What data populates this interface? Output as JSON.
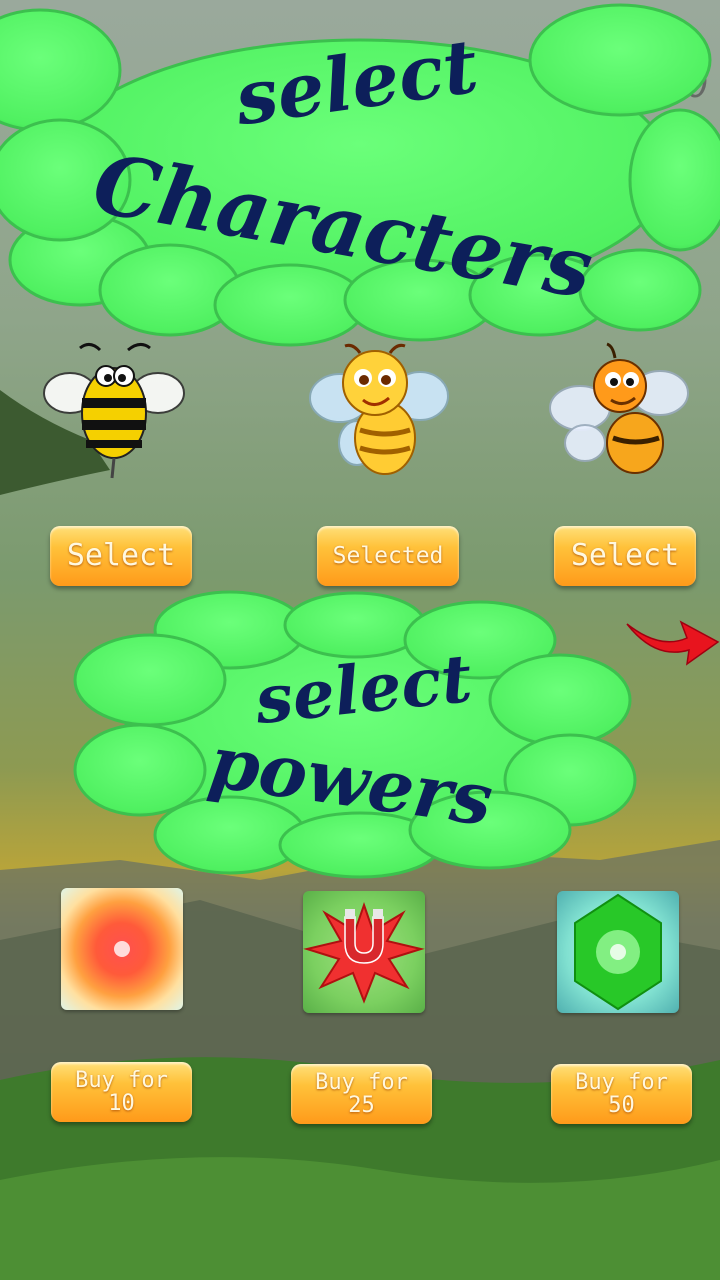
{
  "score": "20000",
  "header": {
    "line1": "select",
    "line2": "Characters"
  },
  "characters": [
    {
      "name": "striped-bee",
      "button_label": "Select"
    },
    {
      "name": "yellow-bee",
      "button_label": "Selected"
    },
    {
      "name": "orange-bee",
      "button_label": "Select"
    }
  ],
  "next_arrow": "next-arrow-icon",
  "powers_header": {
    "line1": "select",
    "line2": "powers"
  },
  "powers": [
    {
      "icon": "fire-burst-icon",
      "button_line1": "Buy for",
      "button_line2": "10"
    },
    {
      "icon": "magnet-icon",
      "button_line1": "Buy for",
      "button_line2": "25"
    },
    {
      "icon": "green-gem-icon",
      "button_line1": "Buy for",
      "button_line2": "50"
    }
  ],
  "colors": {
    "blob": "#55f065",
    "title": "#0d1f5a",
    "button": "#ffb02e"
  }
}
